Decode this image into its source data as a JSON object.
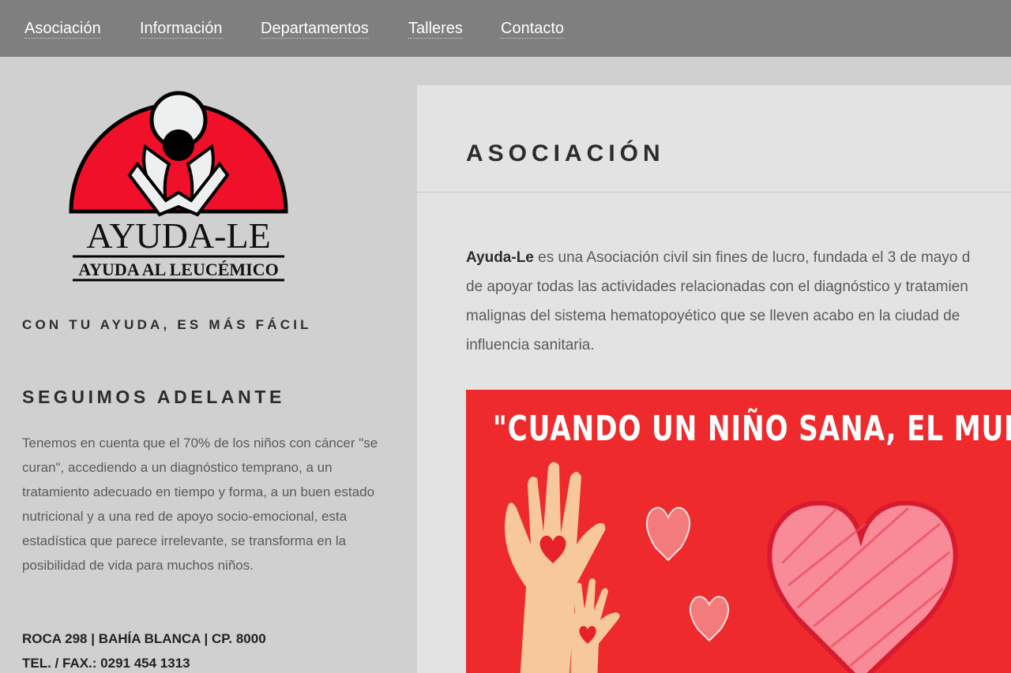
{
  "nav": {
    "items": [
      {
        "label": "Asociación"
      },
      {
        "label": "Información"
      },
      {
        "label": "Departamentos"
      },
      {
        "label": "Talleres"
      },
      {
        "label": "Contacto"
      }
    ]
  },
  "sidebar": {
    "logo": {
      "name": "AYUDA-LE",
      "subtitle": "AYUDA AL LEUCÉMICO"
    },
    "tagline": "CON TU AYUDA, ES MÁS FÁCIL",
    "section_title": "SEGUIMOS ADELANTE",
    "section_text": "Tenemos en cuenta que el 70% de los niños con cáncer \"se curan\", accediendo a un diagnóstico temprano, a un tratamiento adecuado en tiempo y forma, a un buen estado nutricional y a una red de apoyo socio-emocional, esta estadística que parece irrelevante, se transforma en la posibilidad de vida para muchos niños.",
    "address": "ROCA 298 | BAHÍA BLANCA | CP. 8000",
    "phone": "TEL. / FAX.: 0291 454 1313"
  },
  "main": {
    "title": "ASOCIACIÓN",
    "intro_bold": "Ayuda-Le",
    "intro_line1": " es una Asociación civil sin fines de lucro, fundada el 3 de mayo d",
    "intro_line2": "de apoyar todas las actividades relacionadas con el diagnóstico y tratamien",
    "intro_line3": "malignas del sistema hematopoyético que se lleven acabo en la ciudad de",
    "intro_line4": "influencia sanitaria.",
    "banner_quote": "\"CUANDO UN NIÑO SANA, EL MUNDO"
  },
  "colors": {
    "nav_bg": "#7f7f7f",
    "sidebar_bg": "#d0d0d0",
    "main_bg": "#e3e3e3",
    "logo_red": "#f0102a",
    "banner_red": "#ef2a2c"
  }
}
